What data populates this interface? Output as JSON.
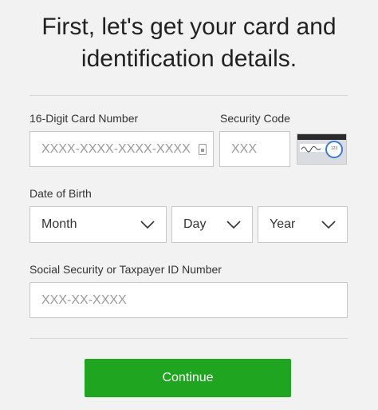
{
  "header": {
    "title_line1": "First, let's get your card and",
    "title_line2": "identification details."
  },
  "card": {
    "label": "16-Digit Card Number",
    "placeholder": "XXXX-XXXX-XXXX-XXXX"
  },
  "security": {
    "label": "Security Code",
    "placeholder": "XXX",
    "example_code": "123"
  },
  "dob": {
    "label": "Date of Birth",
    "month": "Month",
    "day": "Day",
    "year": "Year"
  },
  "ssn": {
    "label": "Social Security or Taxpayer ID Number",
    "placeholder": "XXX-XX-XXXX"
  },
  "actions": {
    "continue_label": "Continue"
  },
  "colors": {
    "accent": "#1fa51f",
    "background": "#f2f2f2"
  }
}
